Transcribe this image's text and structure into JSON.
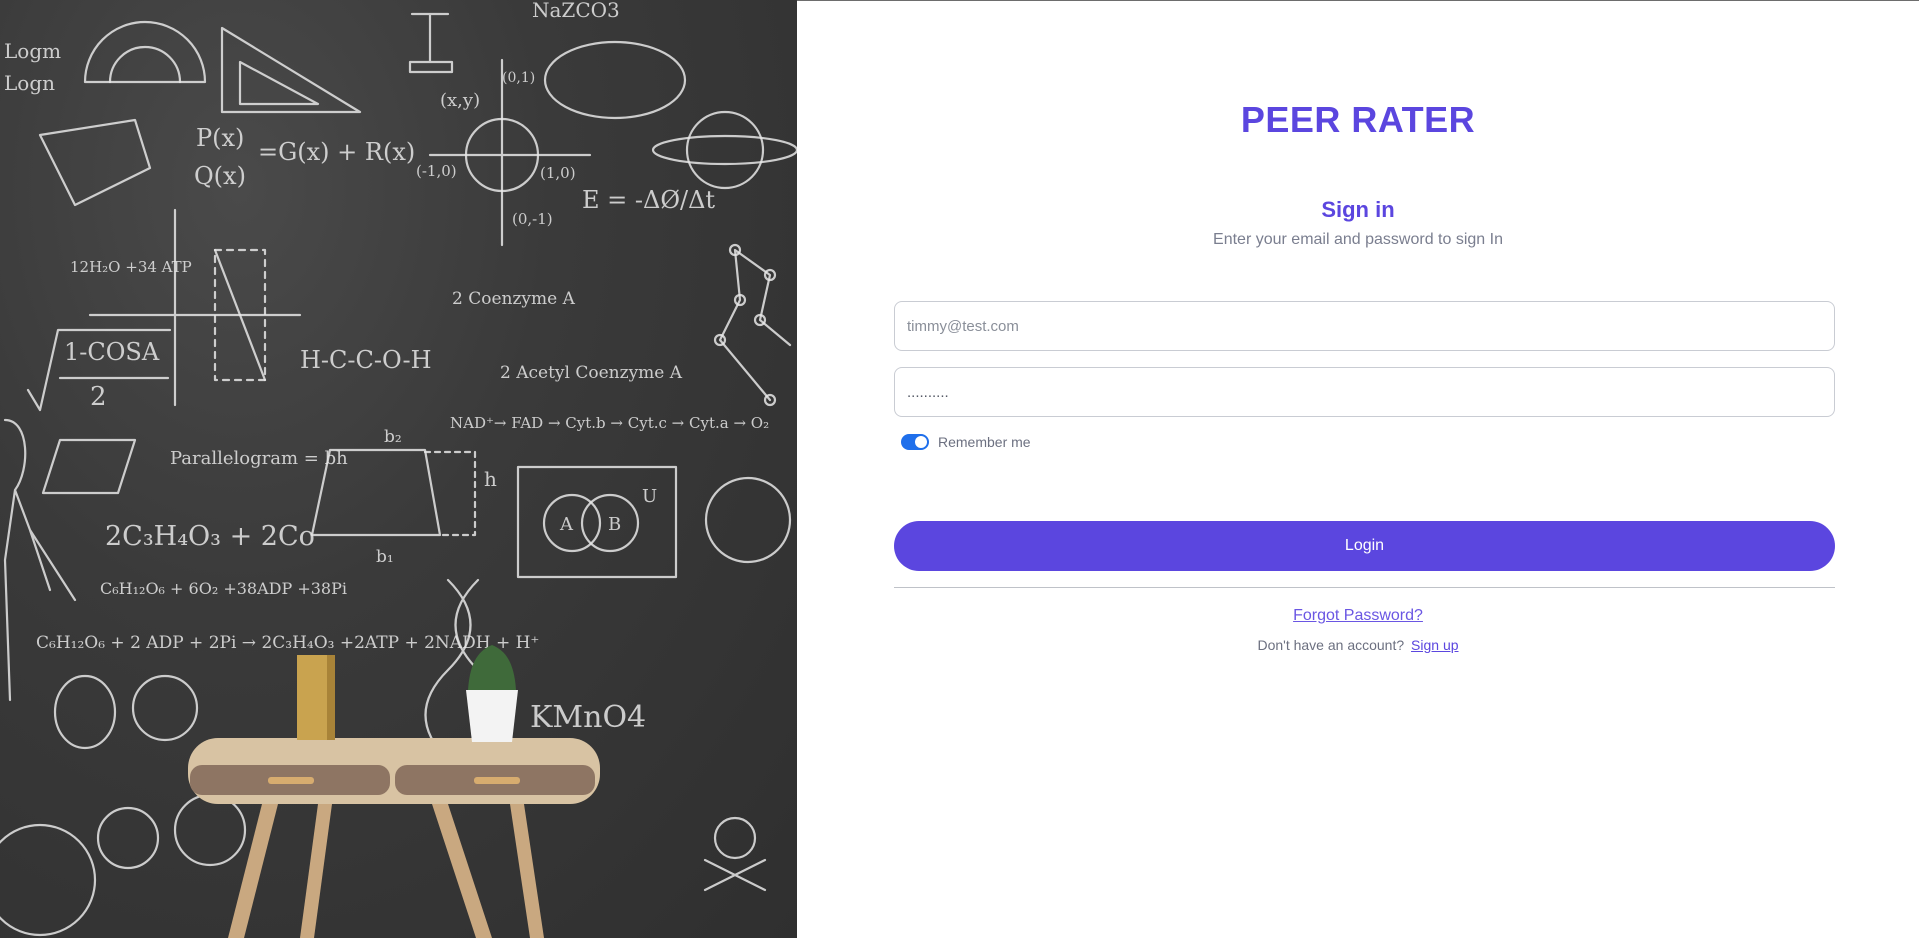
{
  "brand": {
    "title": "PEER RATER"
  },
  "signin": {
    "heading": "Sign in",
    "subheading": "Enter your email and password to sign In",
    "email": {
      "value": "",
      "placeholder": "timmy@test.com"
    },
    "password": {
      "value": "..........",
      "placeholder": ""
    },
    "remember": {
      "label": "Remember me",
      "checked": true
    },
    "login_label": "Login",
    "forgot_label": "Forgot Password?",
    "no_account_text": "Don't have an account?",
    "signup_label": "Sign up"
  },
  "hero": {
    "chalk_texts": [
      "Logm",
      "Logn",
      "NaZCO3",
      "(x,y)",
      "(0,1)",
      "(-1,0)",
      "(1,0)",
      "(0,-1)",
      "P(x)",
      "Q(x)",
      "=G(x) + R(x)",
      "E = -ΔØ/Δt",
      "12H₂O +34 ATP",
      "1-COSA",
      "2",
      "H-C-C-O-H",
      "2 Coenzyme A",
      "2 Acetyl Coenzyme A",
      "NAD⁺→ FAD → Cyt.b → Cyt.c → Cyt.a → O₂",
      "Parallelogram = bh",
      "2C₃H₄O₃ + 2Co",
      "C₆H₁₂O₆ + 6O₂ +38ADP +38Pi",
      "C₆H₁₂O₆ + 2 ADP + 2Pi → 2C₃H₄O₃ +2ATP + 2NADH + H⁺",
      "KMnO4",
      "A",
      "B",
      "U",
      "b₂",
      "b₁",
      "h"
    ],
    "colors": {
      "board": "#3a3a3a",
      "chalk": "#e6e6e6"
    }
  },
  "colors": {
    "accent": "#5b46df",
    "toggle": "#1f6feb",
    "muted_text": "#7a7e8f"
  }
}
